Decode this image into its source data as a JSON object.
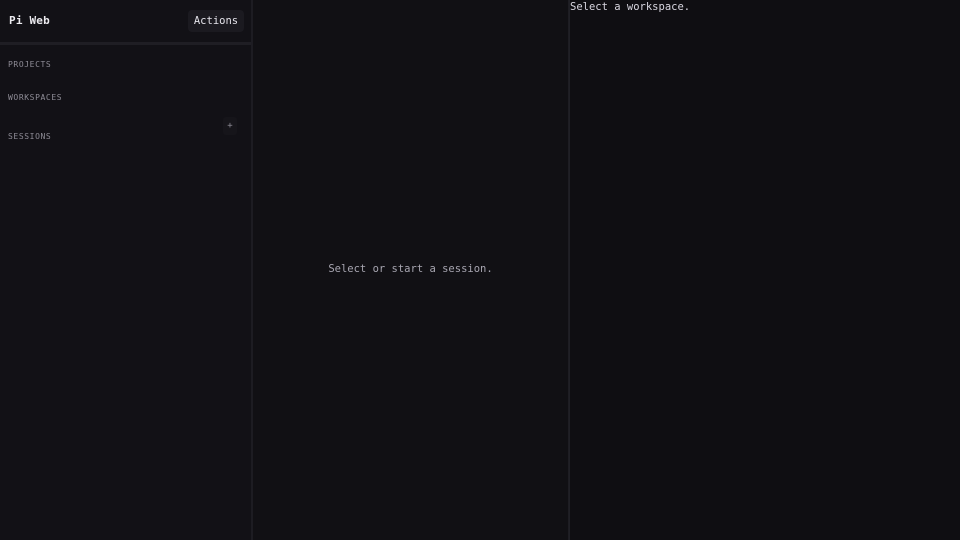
{
  "sidebar": {
    "app_title": "Pi Web",
    "actions_label": "Actions",
    "sections": {
      "projects": "PROJECTS",
      "workspaces": "WORKSPACES",
      "sessions": "SESSIONS"
    },
    "add_session_label": "+"
  },
  "main": {
    "empty_message": "Select or start a session."
  },
  "workspace": {
    "empty_message": "Select a workspace."
  },
  "colors": {
    "background": "#111014",
    "sidebar": "#121116",
    "button": "#1b1a20",
    "text_primary": "#ecebf0",
    "text_muted": "#8e8c96"
  }
}
